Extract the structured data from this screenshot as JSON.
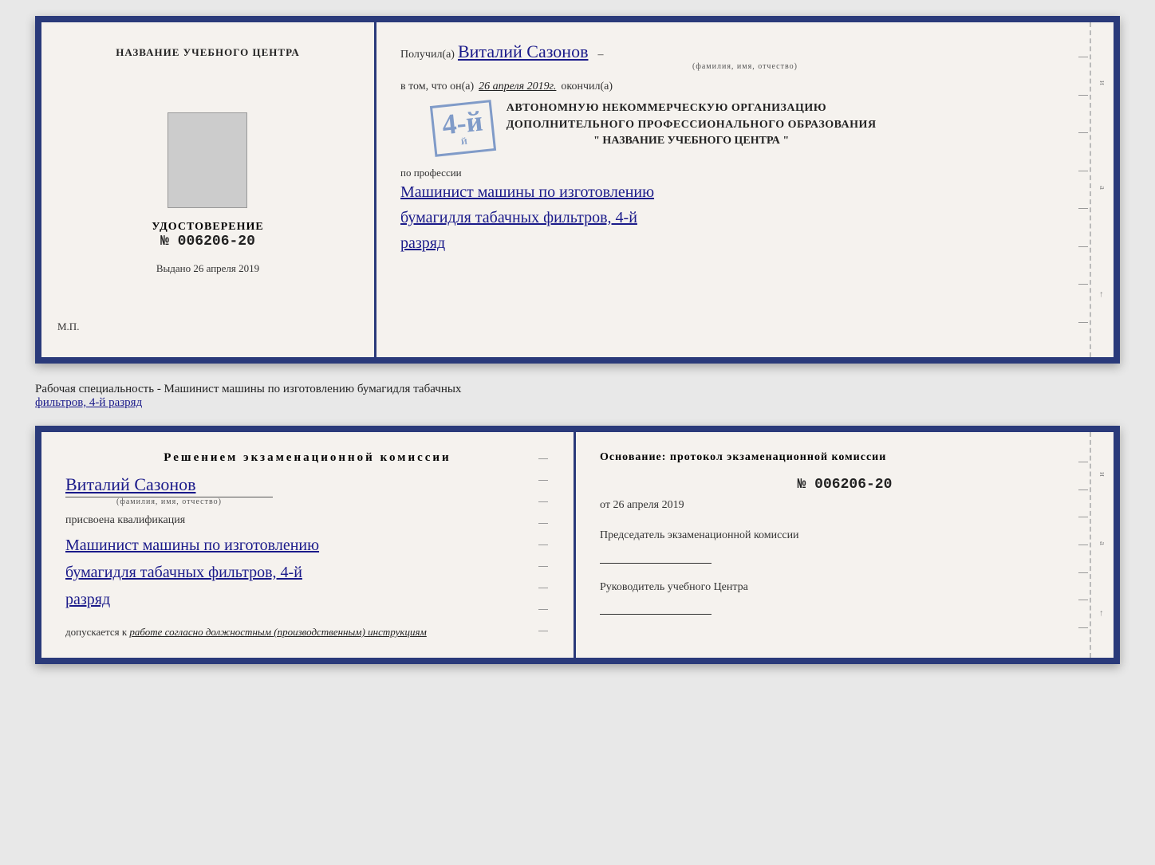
{
  "top_diploma": {
    "left": {
      "title": "НАЗВАНИЕ УЧЕБНОГО ЦЕНТРА",
      "cert_label": "УДОСТОВЕРЕНИЕ",
      "cert_number": "№ 006206-20",
      "issued_label": "Выдано",
      "issued_date": "26 апреля 2019",
      "mp_label": "М.П."
    },
    "right": {
      "poluchil_prefix": "Получил(а)",
      "recipient_name": "Виталий Сазонов",
      "fio_label": "(фамилия, имя, отчество)",
      "dash": "–",
      "vtom_prefix": "в том, что он(а)",
      "vtom_date": "26 апреля 2019г.",
      "okonchil": "окончил(а)",
      "stamp_num": "4-й",
      "org_line1": "АВТОНОМНУЮ НЕКОММЕРЧЕСКУЮ ОРГАНИЗАЦИЮ",
      "org_line2": "ДОПОЛНИТЕЛЬНОГО ПРОФЕССИОНАЛЬНОГО ОБРАЗОВАНИЯ",
      "uchebn_name": "\" НАЗВАНИЕ УЧЕБНОГО ЦЕНТРА \"",
      "po_professii": "по профессии",
      "profession_line1": "Машинист машины по изготовлению",
      "profession_line2": "бумагидля табачных фильтров, 4-й",
      "profession_line3": "разряд"
    }
  },
  "between_text": {
    "label": "Рабочая специальность - Машинист машины по изготовлению бумагидля табачных",
    "label2": "фильтров, 4-й разряд"
  },
  "bottom_diploma": {
    "left": {
      "resheniem_title": "Решением  экзаменационной  комиссии",
      "recipient_name": "Виталий Сазонов",
      "fio_label": "(фамилия, имя, отчество)",
      "prisvoyena": "присвоена квалификация",
      "profession_line1": "Машинист машины по изготовлению",
      "profession_line2": "бумагидля табачных фильтров, 4-й",
      "profession_line3": "разряд",
      "dopusk_prefix": "допускается к",
      "dopusk_italic": "работе согласно должностным (производственным) инструкциям"
    },
    "right": {
      "osnovaniye_label": "Основание: протокол экзаменационной  комиссии",
      "nomer": "№  006206-20",
      "ot_prefix": "от",
      "ot_date": "26 апреля 2019",
      "predsedatel_label": "Председатель экзаменационной комиссии",
      "rukovoditel_label": "Руководитель учебного Центра"
    }
  }
}
